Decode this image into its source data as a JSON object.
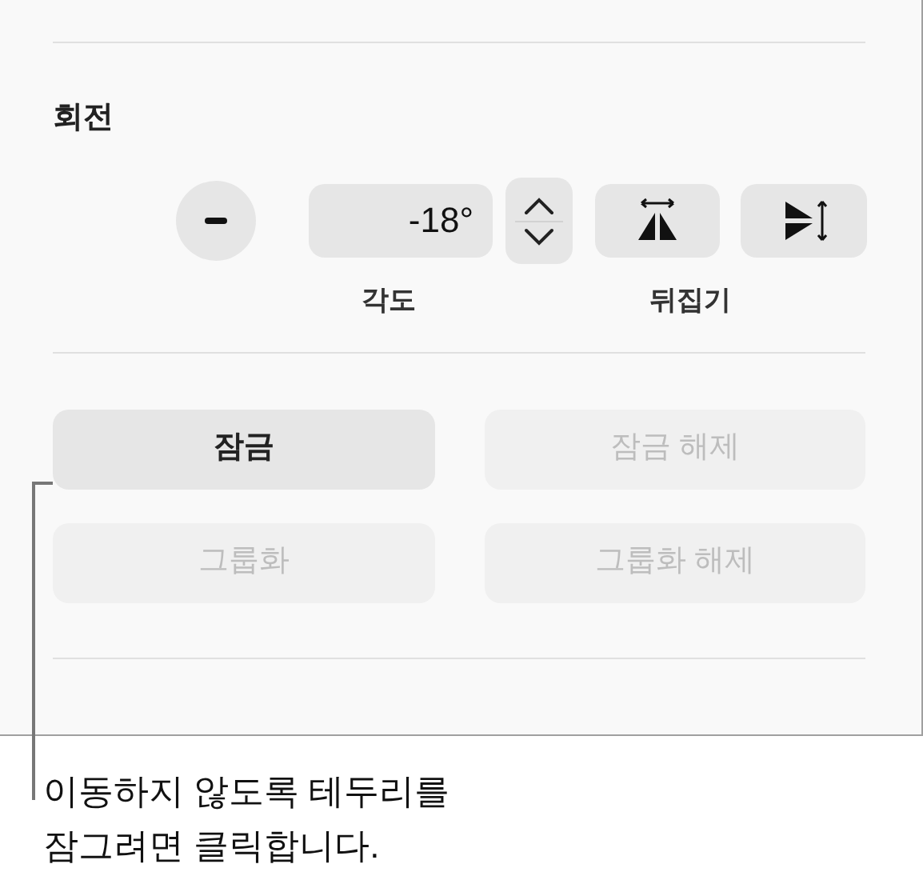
{
  "rotate": {
    "title": "회전",
    "angle_field": {
      "value": "-18°"
    },
    "angle_label": "각도",
    "flip_label": "뒤집기"
  },
  "buttons": [
    {
      "label": "잠금",
      "disabled": false
    },
    {
      "label": "잠금 해제",
      "disabled": true
    },
    {
      "label": "그룹화",
      "disabled": true
    },
    {
      "label": "그룹화 해제",
      "disabled": true
    }
  ],
  "callout": "이동하지 않도록 테두리를\n잠그려면 클릭합니다."
}
